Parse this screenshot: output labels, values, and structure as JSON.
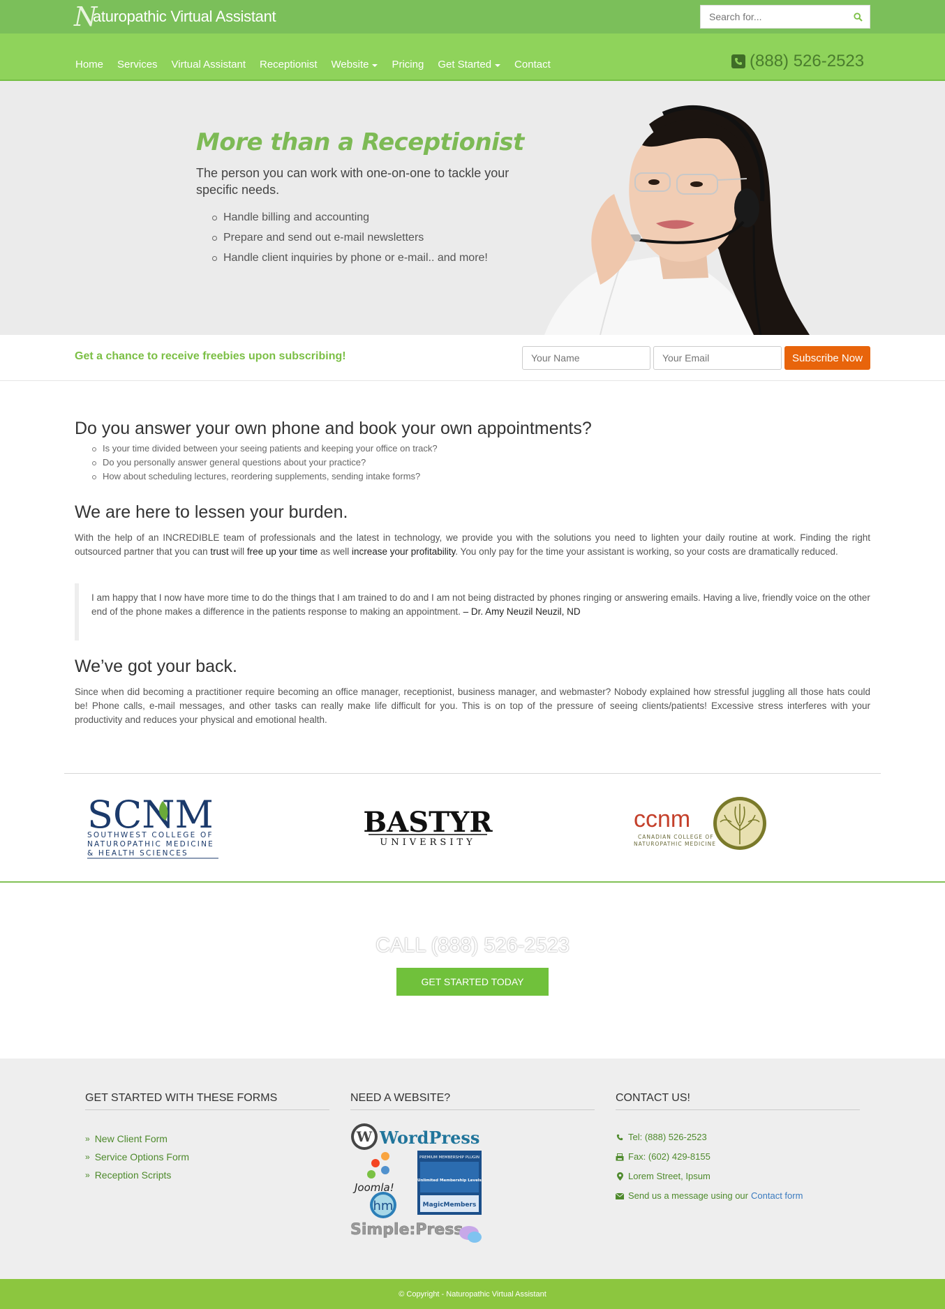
{
  "header": {
    "logo_text": "aturopathic Virtual Assistant",
    "logo_initial": "N",
    "search_placeholder": "Search for...",
    "phone": "(888) 526-2523"
  },
  "nav": {
    "items": [
      {
        "label": "Home"
      },
      {
        "label": "Services"
      },
      {
        "label": "Virtual Assistant"
      },
      {
        "label": "Receptionist"
      },
      {
        "label": "Website"
      },
      {
        "label": "Pricing"
      },
      {
        "label": "Get Started"
      },
      {
        "label": "Contact"
      }
    ]
  },
  "hero": {
    "title": "More than a Receptionist",
    "lead": "The person you can work with one-on-one to tackle your specific needs.",
    "bullets": [
      "Handle billing and accounting",
      "Prepare and send out e-mail newsletters",
      "Handle client inquiries by phone or e-mail.. and more!"
    ]
  },
  "subscribe": {
    "text": "Get a chance to receive freebies upon subscribing!",
    "name_placeholder": "Your Name",
    "email_placeholder": "Your Email",
    "button": "Subscribe Now"
  },
  "section1": {
    "heading": "Do you answer your own phone and book your own appointments?",
    "items": [
      "Is your time divided between your seeing patients and keeping your office on track?",
      "Do you personally answer general questions about your practice?",
      "How about scheduling lectures, reordering supplements, sending intake forms?"
    ]
  },
  "section2": {
    "heading": "We are here to lessen your burden.",
    "p1": "With the help of an INCREDIBLE team of professionals and the latest in technology, we provide you with the solutions you need to lighten your daily routine at work. Finding the right outsourced partner that you can ",
    "b1": "trust",
    "p2": " will ",
    "b2": "free up your time",
    "p3": " as well ",
    "b3": "increase your profitability",
    "p4": ". You only pay for the time your assistant is working, so your costs are dramatically reduced."
  },
  "quote": {
    "text": "I am happy that I now have more time to do the things that I am trained to do and I am not being distracted by phones ringing or answering emails. Having a live, friendly voice on the other end of the phone makes a difference in the patients response to making an appointment. ",
    "author": "– Dr. Amy Neuzil Neuzil, ND"
  },
  "section3": {
    "heading": "We’ve got your back.",
    "body": "Since when did becoming a practitioner require becoming an office manager, receptionist, business manager, and webmaster? Nobody explained how stressful juggling all those hats could be! Phone calls, e-mail messages, and other tasks can really make life difficult for you. This is on top of the pressure of seeing clients/patients! Excessive stress interferes with your productivity and reduces your physical and emotional health."
  },
  "logos": {
    "scnm": {
      "mark": "SCNM",
      "line1": "SOUTHWEST COLLEGE OF",
      "line2": "NATUROPATHIC MEDICINE",
      "line3": "& HEALTH SCIENCES"
    },
    "bastyr": {
      "mark": "BASTYR",
      "sub": "UNIVERSITY"
    },
    "ccnm": {
      "mark": "ccnm",
      "line1": "CANADIAN COLLEGE OF",
      "line2": "NATUROPATHIC MEDICINE"
    }
  },
  "cta": {
    "call": "CALL (888) 526-2523",
    "button": "GET STARTED TODAY"
  },
  "footer": {
    "col1": {
      "title": "GET STARTED WITH THESE FORMS",
      "links": [
        "New Client Form",
        "Service Options Form",
        "Reception Scripts"
      ]
    },
    "col2": {
      "title": "NEED A WEBSITE?",
      "wordpress": "WordPress",
      "joomla": "Joomla!",
      "magic_top": "PREMIUM MEMBERSHIP PLUGIN",
      "magic_mid": "Unlimited Membership Levels",
      "magic_bottom": "MagicMembers",
      "simplepress": "Simple:Press"
    },
    "col3": {
      "title": "CONTACT US!",
      "tel": "Tel: (888) 526-2523",
      "fax": "Fax: (602) 429-8155",
      "address": "Lorem Street, Ipsum",
      "message": "Send us a message using our",
      "link": "Contact form"
    }
  },
  "copyright": "© Copyright - Naturopathic Virtual Assistant",
  "colors": {
    "topbar": "#7bbf5a",
    "navbar": "#8fd35b",
    "accent_green": "#7dba55",
    "subscribe_button": "#e8640b",
    "cta_button": "#70c13b",
    "footer_bar": "#8cc63f"
  }
}
